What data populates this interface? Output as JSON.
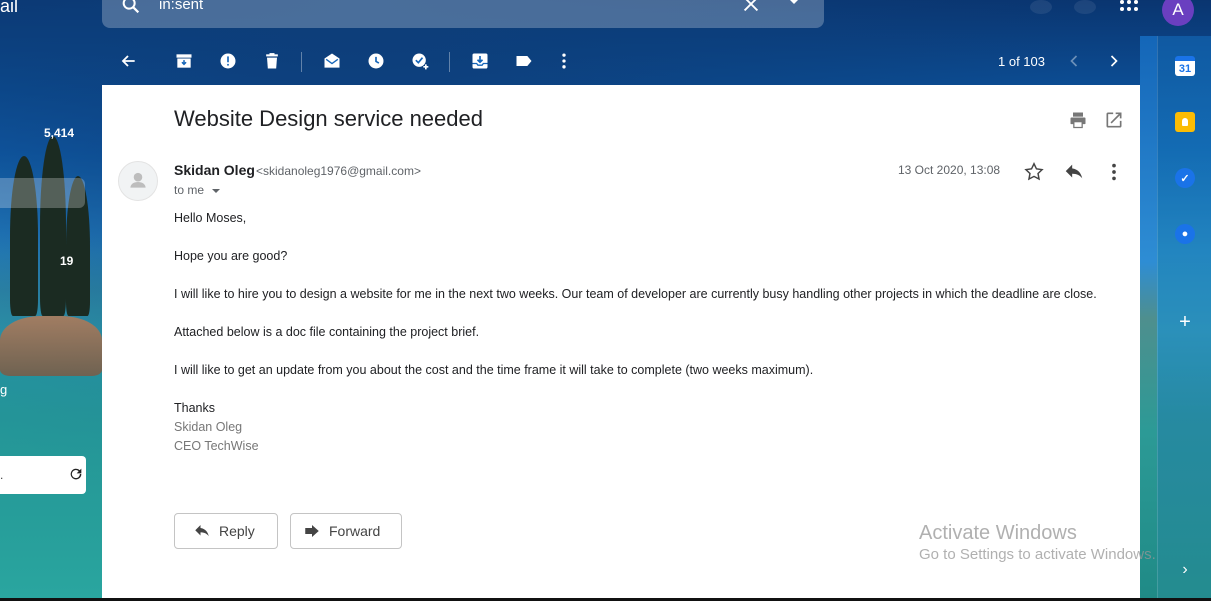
{
  "app": {
    "brand_fragment": "ail"
  },
  "search": {
    "query": "in:sent"
  },
  "account": {
    "avatar_letter": "A"
  },
  "left_nav": {
    "count_inbox": "5,414",
    "count_other": "19",
    "letter_fragment": "g"
  },
  "toolbar": {
    "pager": "1 of 103"
  },
  "message": {
    "subject": "Website Design service needed",
    "sender_name": "Skidan Oleg",
    "sender_email": "<skidanoleg1976@gmail.com>",
    "to": "to me",
    "date": "13 Oct 2020, 13:08",
    "body": {
      "greeting": "Hello Moses,",
      "p1": "Hope you are good?",
      "p2": "I will like to hire you to design a website for me in the next two weeks. Our team of developer are currently busy handling other projects in which the deadline are close.",
      "p3": "Attached below is a doc file containing the project brief.",
      "p4": "I will like to get an update from you about the cost and the time frame it will take to complete (two weeks maximum).",
      "thanks": "Thanks",
      "sig_name": "Skidan Oleg",
      "sig_title": "CEO TechWise"
    }
  },
  "actions": {
    "reply": "Reply",
    "forward": "Forward"
  },
  "side_apps": {
    "calendar_day": "31"
  },
  "watermark": {
    "line1": "Activate Windows",
    "line2": "Go to Settings to activate Windows."
  },
  "colors": {
    "accent_avatar": "#6a3fc0",
    "panel_bg": "#ffffff"
  }
}
